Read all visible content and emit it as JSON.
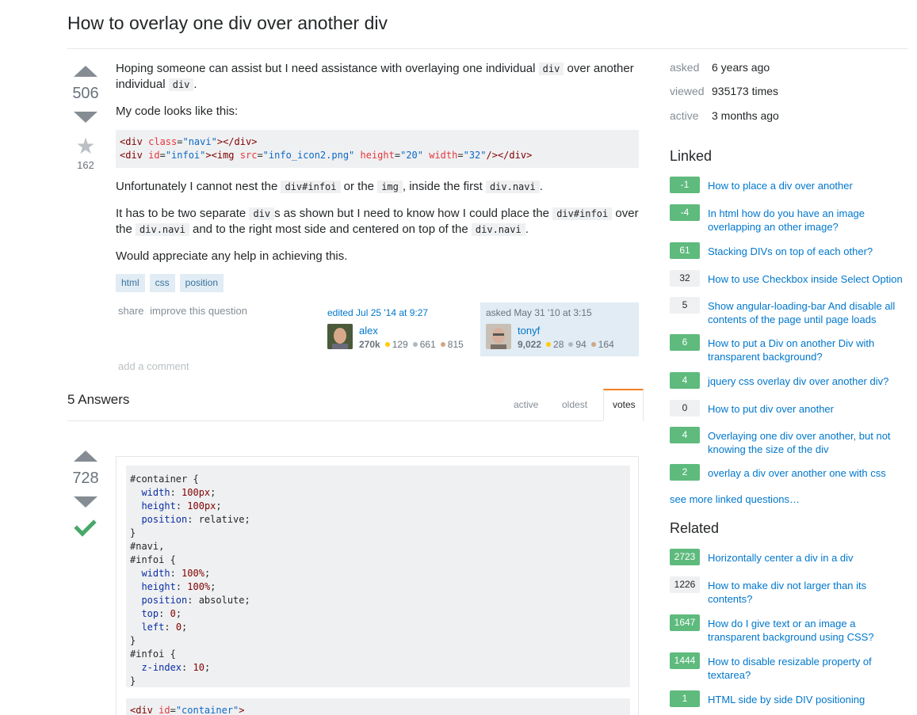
{
  "question": {
    "title": "How to overlay one div over another div",
    "votes": "506",
    "favorites": "162",
    "body": {
      "p1_a": "Hoping someone can assist but I need assistance with overlaying one individual ",
      "p1_code": "div",
      "p1_b": " over another individual ",
      "p1_code2": "div",
      "p1_c": ".",
      "p2": "My code looks like this:",
      "p3_a": "Unfortunately I cannot nest the ",
      "p3_code1": "div#infoi",
      "p3_b": " or the ",
      "p3_code2": "img",
      "p3_c": ", inside the first ",
      "p3_code3": "div.navi",
      "p3_d": ".",
      "p4_a": "It has to be two separate ",
      "p4_code1": "div",
      "p4_b": "s as shown but I need to know how I could place the ",
      "p4_code2": "div#infoi",
      "p4_c": " over the ",
      "p4_code3": "div.navi",
      "p4_d": " and to the right most side and centered on top of the ",
      "p4_code4": "div.navi",
      "p4_e": ".",
      "p5": "Would appreciate any help in achieving this."
    },
    "code": {
      "l1_open": "<div ",
      "l1_attr": "class",
      "l1_eq": "=",
      "l1_val": "\"navi\"",
      "l1_close": "></div>",
      "l2_open": "<div ",
      "l2_attr1": "id",
      "l2_eq1": "=",
      "l2_val1": "\"infoi\"",
      "l2_gt": "><img ",
      "l2_attr2": "src",
      "l2_eq2": "=",
      "l2_val2": "\"info_icon2.png\"",
      "l2_sp1": " ",
      "l2_attr3": "height",
      "l2_eq3": "=",
      "l2_val3": "\"20\"",
      "l2_sp2": " ",
      "l2_attr4": "width",
      "l2_eq4": "=",
      "l2_val4": "\"32\"",
      "l2_close": "/></div>"
    },
    "tags": [
      "html",
      "css",
      "position"
    ],
    "menu": {
      "share": "share",
      "improve": "improve this question"
    },
    "editor": {
      "action": "edited ",
      "date": "Jul 25 '14 at 9:27",
      "name": "alex",
      "rep": "270k",
      "gold": "129",
      "silver": "661",
      "bronze": "815"
    },
    "asker": {
      "action": "asked ",
      "date": "May 31 '10 at 3:15",
      "name": "tonyf",
      "rep": "9,022",
      "gold": "28",
      "silver": "94",
      "bronze": "164"
    },
    "add_comment": "add a comment"
  },
  "answers": {
    "header": "5 Answers",
    "tabs": [
      "active",
      "oldest",
      "votes"
    ],
    "top": {
      "votes": "728",
      "css_lines": [
        [
          [
            "",
            "#container {"
          ]
        ],
        [
          [
            "",
            "  "
          ],
          [
            "prop",
            "width"
          ],
          [
            "",
            ": "
          ],
          [
            "num",
            "100px"
          ],
          [
            "",
            ";"
          ]
        ],
        [
          [
            "",
            "  "
          ],
          [
            "prop",
            "height"
          ],
          [
            "",
            ": "
          ],
          [
            "num",
            "100px"
          ],
          [
            "",
            ";"
          ]
        ],
        [
          [
            "",
            "  "
          ],
          [
            "prop",
            "position"
          ],
          [
            "",
            ": relative;"
          ]
        ],
        [
          [
            "",
            "}"
          ]
        ],
        [
          [
            "",
            "#navi,"
          ]
        ],
        [
          [
            "",
            "#infoi {"
          ]
        ],
        [
          [
            "",
            "  "
          ],
          [
            "prop",
            "width"
          ],
          [
            "",
            ": "
          ],
          [
            "num",
            "100%"
          ],
          [
            "",
            ";"
          ]
        ],
        [
          [
            "",
            "  "
          ],
          [
            "prop",
            "height"
          ],
          [
            "",
            ": "
          ],
          [
            "num",
            "100%"
          ],
          [
            "",
            ";"
          ]
        ],
        [
          [
            "",
            "  "
          ],
          [
            "prop",
            "position"
          ],
          [
            "",
            ": absolute;"
          ]
        ],
        [
          [
            "",
            "  "
          ],
          [
            "prop",
            "top"
          ],
          [
            "",
            ": "
          ],
          [
            "num",
            "0"
          ],
          [
            "",
            ";"
          ]
        ],
        [
          [
            "",
            "  "
          ],
          [
            "prop",
            "left"
          ],
          [
            "",
            ": "
          ],
          [
            "num",
            "0"
          ],
          [
            "",
            ";"
          ]
        ],
        [
          [
            "",
            "}"
          ]
        ],
        [
          [
            "",
            "#infoi {"
          ]
        ],
        [
          [
            "",
            "  "
          ],
          [
            "prop",
            "z-index"
          ],
          [
            "",
            ": "
          ],
          [
            "num",
            "10"
          ],
          [
            "",
            ";"
          ]
        ],
        [
          [
            "",
            "}"
          ]
        ]
      ],
      "html_line": {
        "open": "<div ",
        "attr": "id",
        "eq": "=",
        "val": "\"container\"",
        "close": ">"
      }
    }
  },
  "sidebar": {
    "meta": [
      {
        "label": "asked",
        "value": "6 years ago"
      },
      {
        "label": "viewed",
        "value": "935173 times"
      },
      {
        "label": "active",
        "value": "3 months ago"
      }
    ],
    "linked_title": "Linked",
    "linked": [
      {
        "score": "-1",
        "answered": true,
        "title": "How to place a div over another"
      },
      {
        "score": "-4",
        "answered": true,
        "title": "In html how do you have an image overlapping an other image?"
      },
      {
        "score": "61",
        "answered": true,
        "title": "Stacking DIVs on top of each other?"
      },
      {
        "score": "32",
        "answered": false,
        "title": "How to use Checkbox inside Select Option"
      },
      {
        "score": "5",
        "answered": false,
        "title": "Show angular-loading-bar And disable all contents of the page until page loads"
      },
      {
        "score": "6",
        "answered": true,
        "title": "How to put a Div on another Div with transparent background?"
      },
      {
        "score": "4",
        "answered": true,
        "title": "jquery css overlay div over another div?"
      },
      {
        "score": "0",
        "answered": false,
        "title": "How to put div over another"
      },
      {
        "score": "4",
        "answered": true,
        "title": "Overlaying one div over another, but not knowing the size of the div"
      },
      {
        "score": "2",
        "answered": true,
        "title": "overlay a div over another one with css"
      }
    ],
    "see_more": "see more linked questions…",
    "related_title": "Related",
    "related": [
      {
        "score": "2723",
        "answered": true,
        "title": "Horizontally center a div in a div"
      },
      {
        "score": "1226",
        "answered": false,
        "title": "How to make div not larger than its contents?"
      },
      {
        "score": "1647",
        "answered": true,
        "title": "How do I give text or an image a transparent background using CSS?"
      },
      {
        "score": "1444",
        "answered": true,
        "title": "How to disable resizable property of textarea?"
      },
      {
        "score": "1",
        "answered": true,
        "title": "HTML side by side DIV positioning"
      }
    ]
  }
}
